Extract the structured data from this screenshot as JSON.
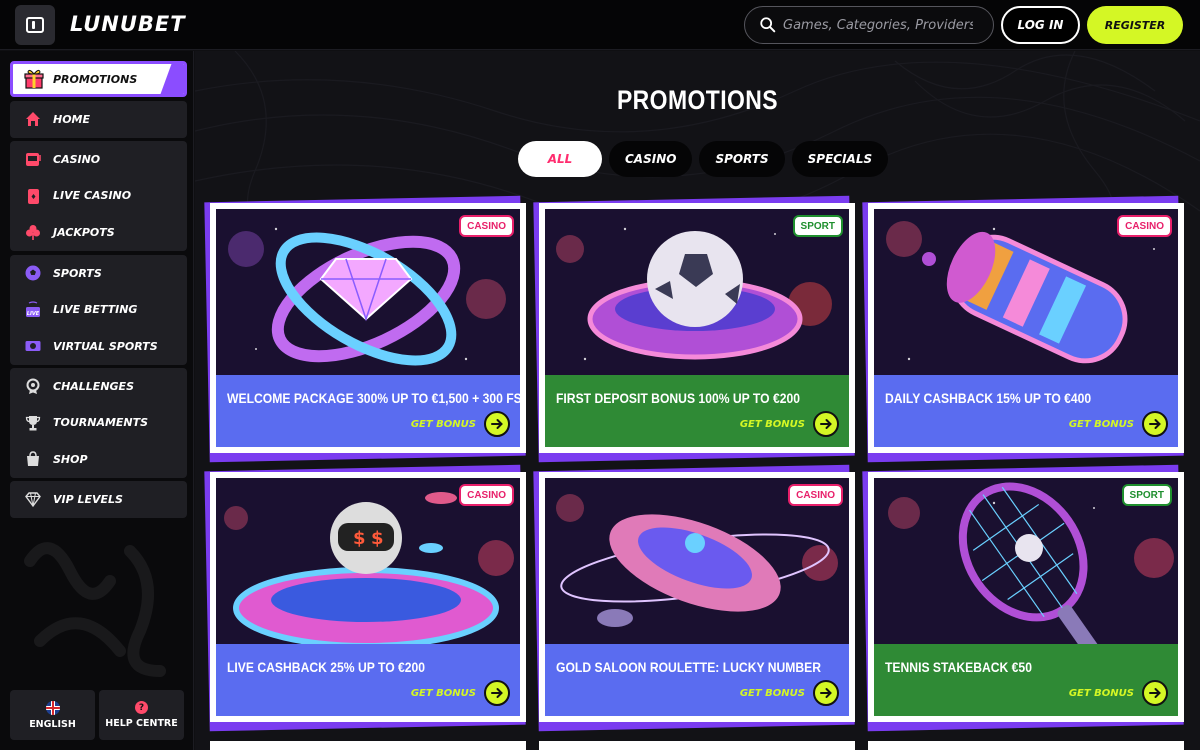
{
  "header": {
    "logo": "LUNUBET",
    "search_placeholder": "Games, Categories, Providers",
    "login_label": "LOG IN",
    "register_label": "REGISTER"
  },
  "sidebar": {
    "promotions_label": "PROMOTIONS",
    "groups": [
      [
        {
          "label": "HOME",
          "icon": "home-icon"
        }
      ],
      [
        {
          "label": "CASINO",
          "icon": "slot-machine-icon"
        },
        {
          "label": "LIVE CASINO",
          "icon": "cards-icon"
        },
        {
          "label": "JACKPOTS",
          "icon": "clover-icon"
        }
      ],
      [
        {
          "label": "SPORTS",
          "icon": "soccer-ball-icon"
        },
        {
          "label": "LIVE BETTING",
          "icon": "live-tv-icon"
        },
        {
          "label": "VIRTUAL SPORTS",
          "icon": "virtual-sports-icon"
        }
      ],
      [
        {
          "label": "CHALLENGES",
          "icon": "medal-icon"
        },
        {
          "label": "TOURNAMENTS",
          "icon": "trophy-icon"
        },
        {
          "label": "SHOP",
          "icon": "shopping-bag-icon"
        }
      ],
      [
        {
          "label": "VIP LEVELS",
          "icon": "diamond-icon"
        }
      ]
    ],
    "language_label": "ENGLISH",
    "help_label": "HELP CENTRE"
  },
  "main": {
    "title": "PROMOTIONS",
    "filters": [
      "ALL",
      "CASINO",
      "SPORTS",
      "SPECIALS"
    ],
    "active_filter": "ALL",
    "cta_label": "GET BONUS",
    "cards": [
      {
        "title": "WELCOME PACKAGE 300% UP TO €1,500 + 300 FS",
        "tag": "CASINO",
        "footer_color": "#5a6cf0",
        "art": "diamond-rings"
      },
      {
        "title": "FIRST DEPOSIT BONUS 100% UP TO €200",
        "tag": "SPORT",
        "footer_color": "#2f8a35",
        "art": "soccer-ufo"
      },
      {
        "title": "DAILY CASHBACK 15% UP TO €400",
        "tag": "CASINO",
        "footer_color": "#5a6cf0",
        "art": "slot-reel"
      },
      {
        "title": "LIVE CASHBACK 25% UP TO €200",
        "tag": "CASINO",
        "footer_color": "#5a6cf0",
        "art": "astronaut-table"
      },
      {
        "title": "GOLD SALOON ROULETTE: LUCKY NUMBER",
        "tag": "CASINO",
        "footer_color": "#5a6cf0",
        "art": "roulette-wheel"
      },
      {
        "title": "TENNIS STAKEBACK €50",
        "tag": "SPORT",
        "footer_color": "#2f8a35",
        "art": "tennis-racket"
      }
    ]
  },
  "colors": {
    "accent_lime": "#d4f725",
    "accent_purple": "#8b4dff",
    "casino_tag": "#e81f6a",
    "sport_tag": "#1f8f2e"
  }
}
